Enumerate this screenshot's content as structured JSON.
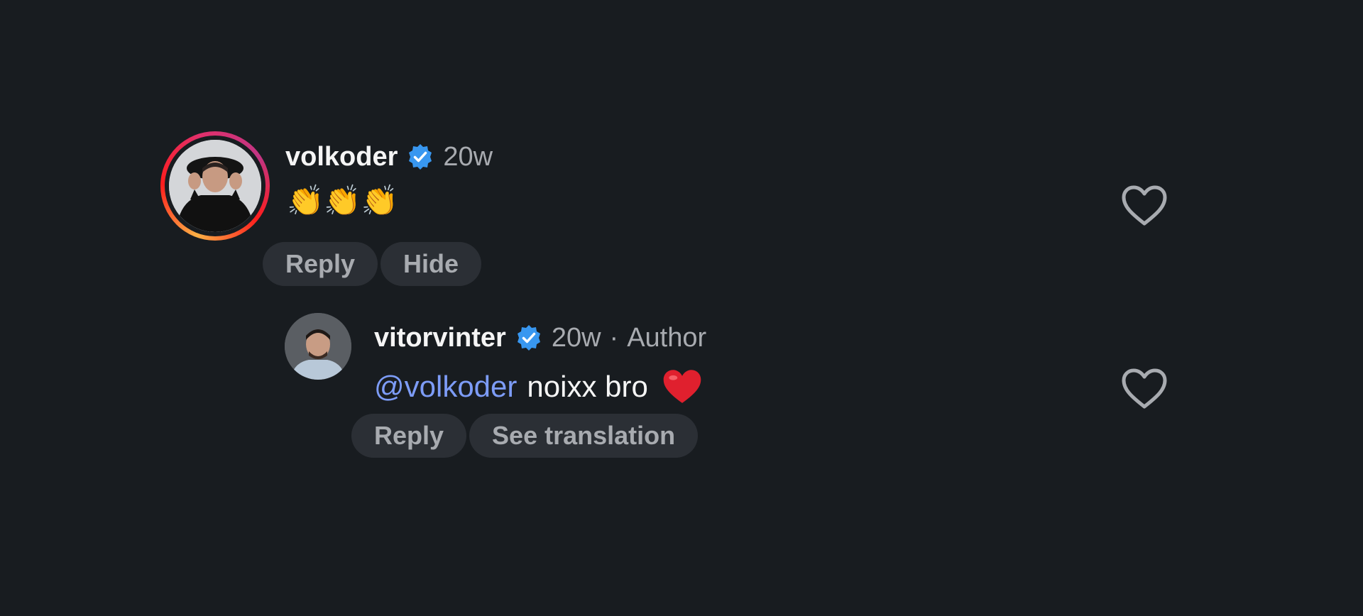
{
  "colors": {
    "background": "#181c20",
    "username": "#f5f5f5",
    "meta": "#a8abb0",
    "mention": "#7d9cf7",
    "pill_bg": "#2b2f35",
    "verified": "#3897f0"
  },
  "comments": [
    {
      "username": "volkoder",
      "verified": true,
      "time": "20w",
      "text": "👏👏👏",
      "actions": [
        "Reply",
        "Hide"
      ],
      "avatar_icon": "story-ring-avatar",
      "like_icon": "heart-outline-icon"
    },
    {
      "username": "vitorvinter",
      "verified": true,
      "time": "20w",
      "separator": "·",
      "role": "Author",
      "mention": "@volkoder",
      "text": "noixx bro",
      "emoji": "heart-red-icon",
      "actions": [
        "Reply",
        "See translation"
      ],
      "like_icon": "heart-outline-icon"
    }
  ]
}
